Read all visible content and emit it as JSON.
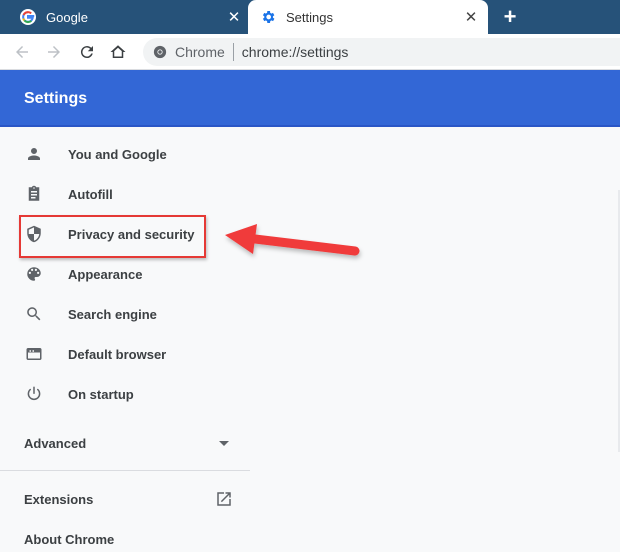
{
  "browser": {
    "tabs": [
      {
        "title": "Google",
        "favicon": "google-g-icon",
        "active": false
      },
      {
        "title": "Settings",
        "favicon": "gear-icon",
        "active": true
      }
    ],
    "close_glyph": "✕",
    "new_tab_glyph": "+",
    "omnibox": {
      "chip_label": "Chrome",
      "url": "chrome://settings"
    }
  },
  "colors": {
    "tabstrip": "#265279",
    "header": "#3367d6",
    "annotation_red": "#e53935"
  },
  "settings": {
    "header_title": "Settings",
    "nav": [
      {
        "label": "You and Google",
        "icon": "person-icon"
      },
      {
        "label": "Autofill",
        "icon": "clipboard-icon"
      },
      {
        "label": "Privacy and security",
        "icon": "shield-icon",
        "highlighted": true
      },
      {
        "label": "Appearance",
        "icon": "palette-icon"
      },
      {
        "label": "Search engine",
        "icon": "search-icon"
      },
      {
        "label": "Default browser",
        "icon": "browser-window-icon"
      },
      {
        "label": "On startup",
        "icon": "power-icon"
      }
    ],
    "advanced_label": "Advanced",
    "extensions_label": "Extensions",
    "about_label": "About Chrome"
  }
}
